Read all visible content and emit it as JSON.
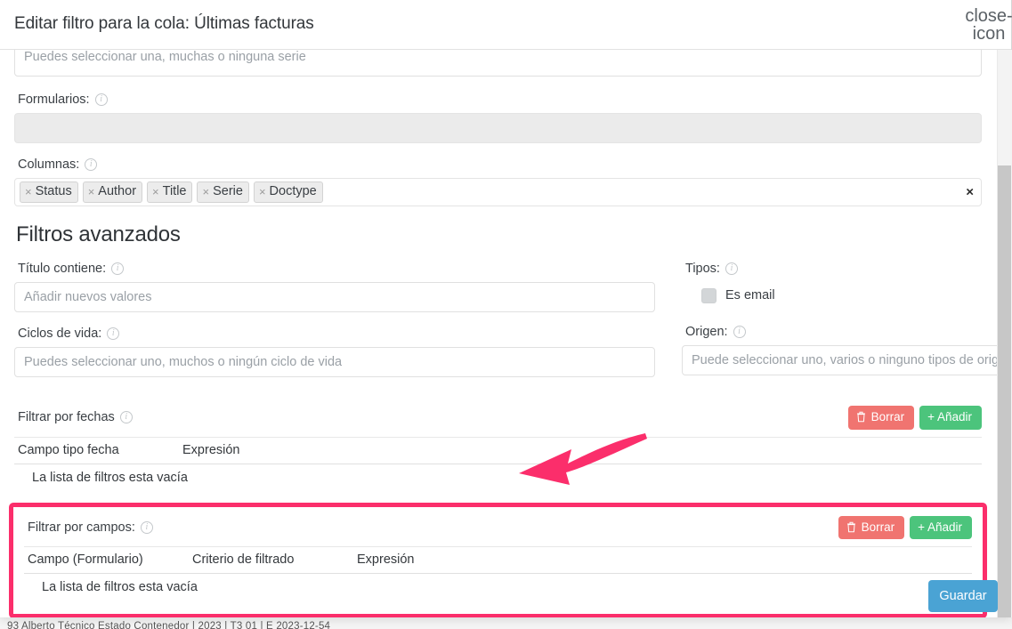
{
  "modal": {
    "title": "Editar filtro para la cola: Últimas facturas",
    "close_icon": "close-icon"
  },
  "series_field": {
    "placeholder": "Puedes seleccionar una, muchas o ninguna serie"
  },
  "formularios": {
    "label": "Formularios:",
    "value": "",
    "info_icon": "info-icon"
  },
  "columnas": {
    "label": "Columnas:",
    "info_icon": "info-icon",
    "clear_icon": "×",
    "tags": [
      {
        "remove": "×",
        "label": "Status"
      },
      {
        "remove": "×",
        "label": "Author"
      },
      {
        "remove": "×",
        "label": "Title"
      },
      {
        "remove": "×",
        "label": "Serie"
      },
      {
        "remove": "×",
        "label": "Doctype"
      }
    ]
  },
  "advanced": {
    "heading": "Filtros avanzados",
    "titulo_contiene": {
      "label": "Título contiene:",
      "placeholder": "Añadir nuevos valores",
      "value": ""
    },
    "ciclos_de_vida": {
      "label": "Ciclos de vida:",
      "placeholder": "Puedes seleccionar uno, muchos o ningún ciclo de vida",
      "value": ""
    },
    "tipos": {
      "label": "Tipos:",
      "checkbox_label": "Es email",
      "checked": false
    },
    "origen": {
      "label": "Origen:",
      "placeholder": "Puede seleccionar uno, varios o ninguno tipos de origen",
      "value": ""
    }
  },
  "date_filters": {
    "title": "Filtrar por fechas",
    "delete_label": "Borrar",
    "add_label": "+ Añadir",
    "delete_icon": "trash-icon",
    "add_icon": "plus-icon",
    "columns": [
      "Campo tipo fecha",
      "Expresión"
    ],
    "empty_text": "La lista de filtros esta vacía"
  },
  "field_filters": {
    "title": "Filtrar por campos:",
    "delete_label": "Borrar",
    "add_label": "+ Añadir",
    "delete_icon": "trash-icon",
    "add_icon": "plus-icon",
    "columns": [
      "Campo (Formulario)",
      "Criterio de filtrado",
      "Expresión"
    ],
    "empty_text": "La lista de filtros esta vacía",
    "highlighted": true
  },
  "footer": {
    "save_label": "Guardar"
  },
  "annotation": {
    "arrow_color": "#fb2e6b",
    "box_color": "#fb2e6b"
  },
  "background": {
    "row_text": "93  Alberto   Técnico   Estado   Contenedor          |       2023 | T3   01 | E        2023-12-54"
  },
  "colors": {
    "accent_pink": "#fb2e6b",
    "danger": "#f07470",
    "success": "#4cc47c",
    "primary": "#4aa3d4"
  }
}
